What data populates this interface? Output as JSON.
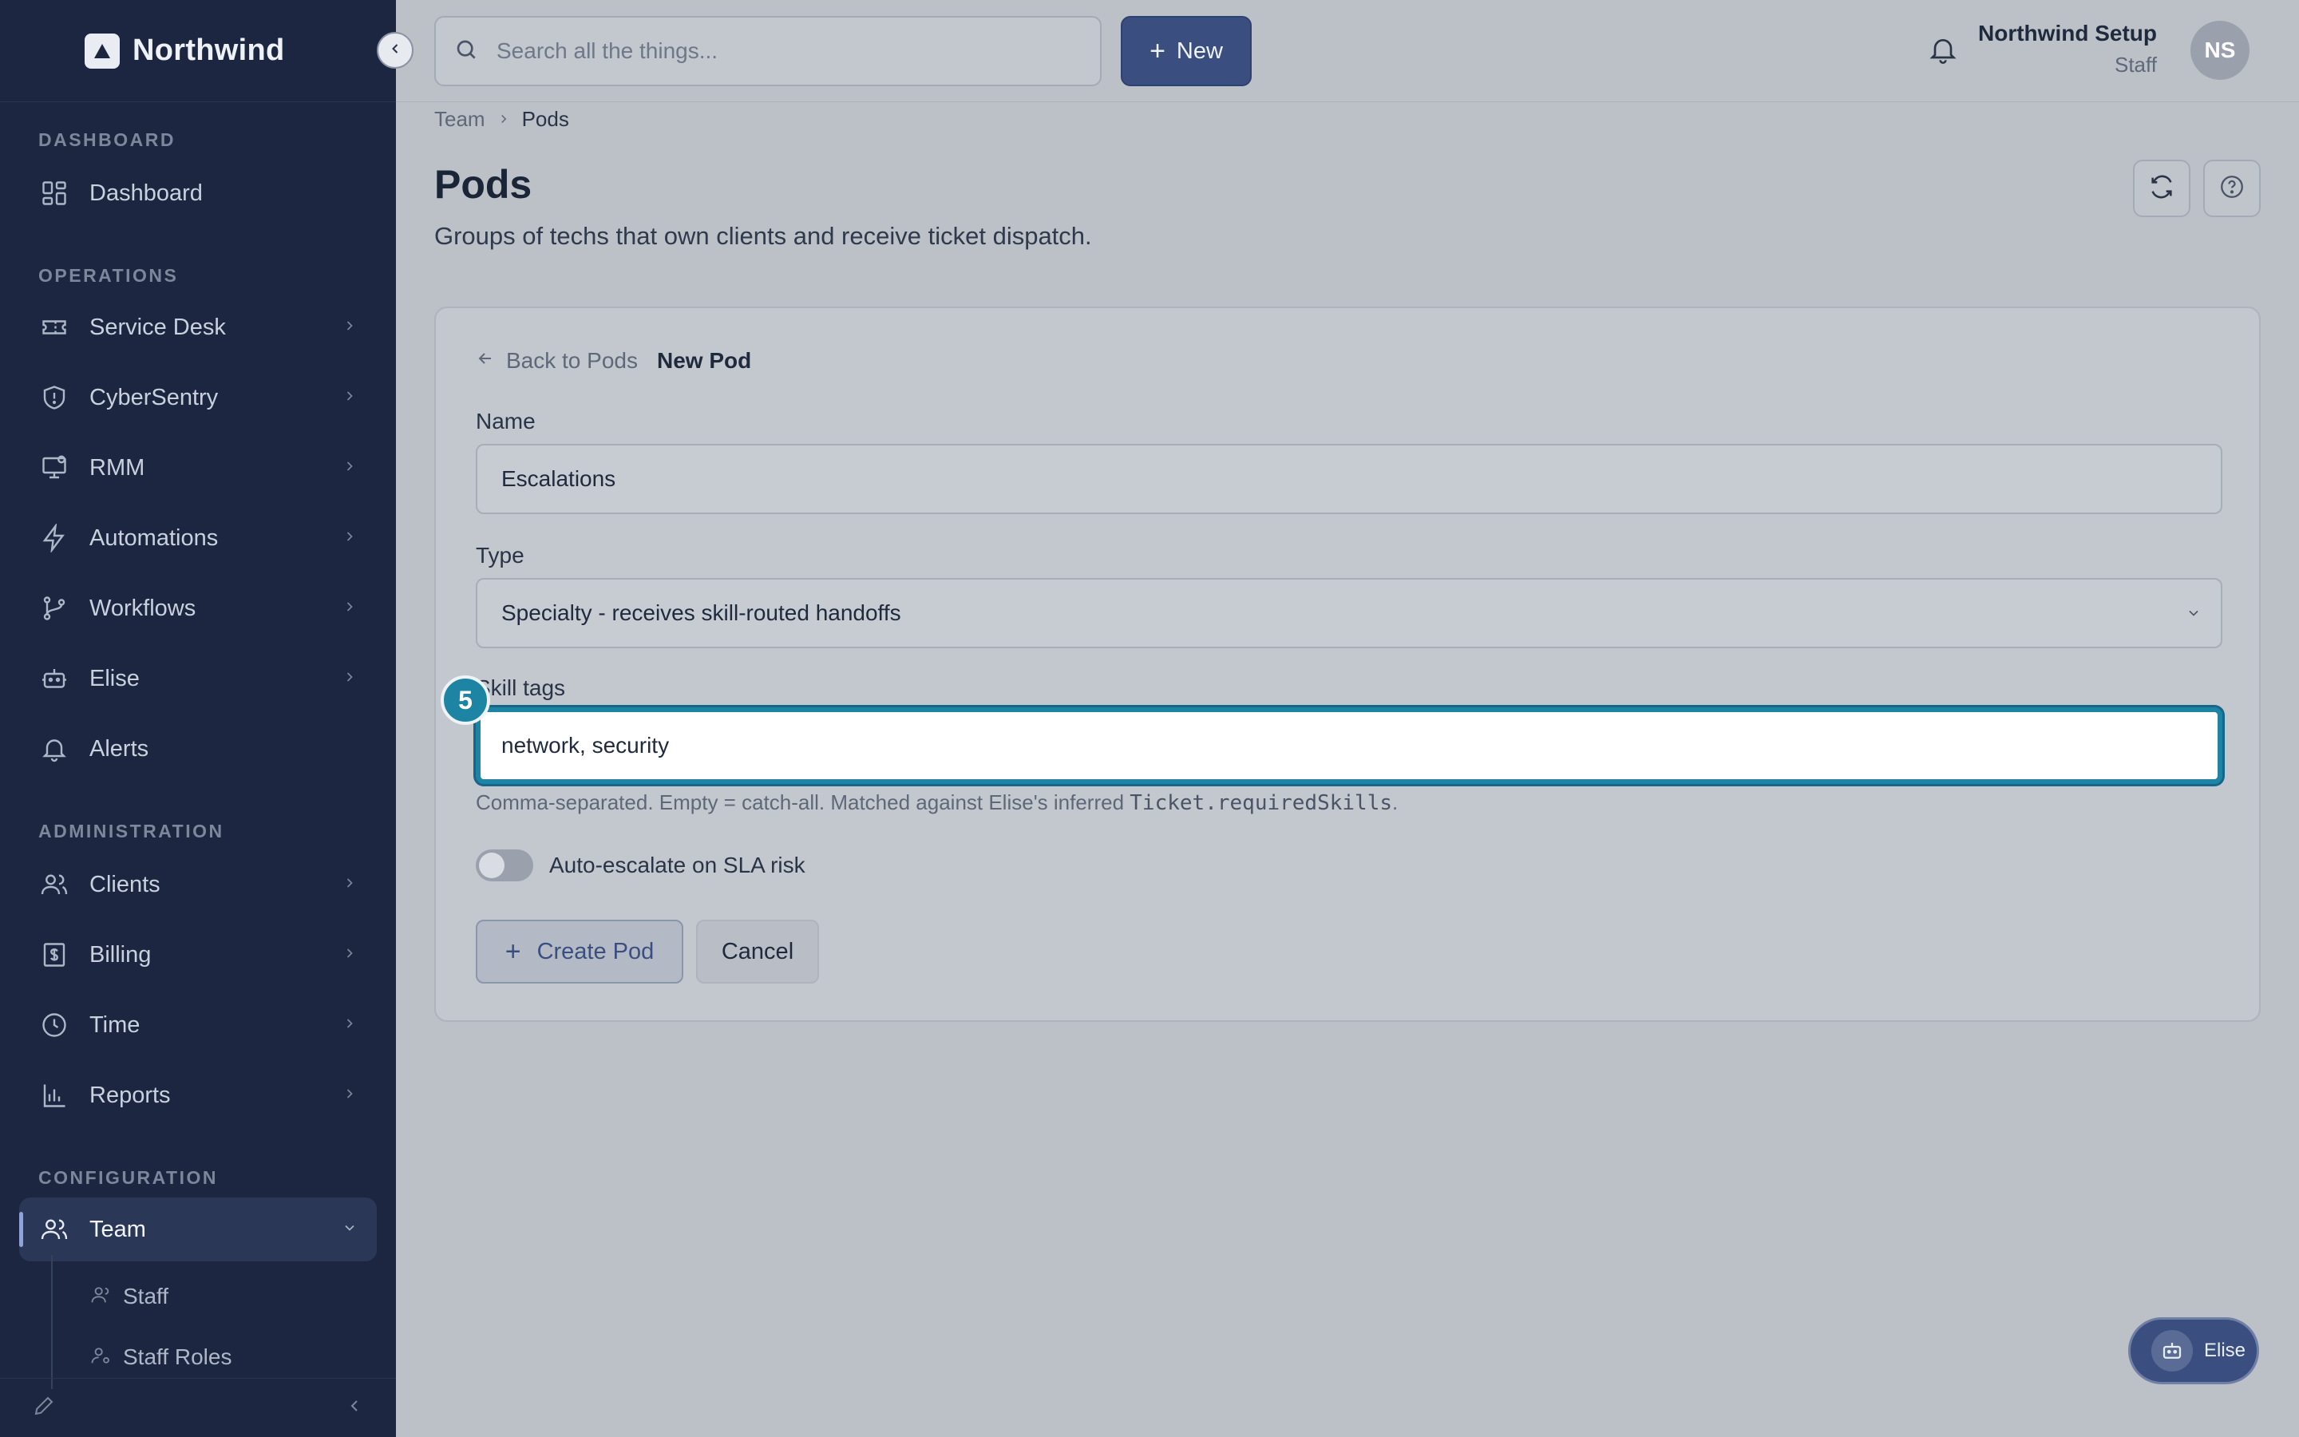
{
  "app": {
    "brand_name": "Northwind"
  },
  "sidebar": {
    "sections": {
      "dashboard": "DASHBOARD",
      "operations": "OPERATIONS",
      "administration": "ADMINISTRATION",
      "configuration": "CONFIGURATION"
    },
    "items": {
      "dashboard": "Dashboard",
      "service_desk": "Service Desk",
      "cybersentry": "CyberSentry",
      "rmm": "RMM",
      "automations": "Automations",
      "workflows": "Workflows",
      "elise": "Elise",
      "alerts": "Alerts",
      "clients": "Clients",
      "billing": "Billing",
      "time": "Time",
      "reports": "Reports",
      "team": "Team"
    },
    "sub_items": {
      "staff": "Staff",
      "staff_roles": "Staff Roles"
    },
    "active_item": "Team"
  },
  "topbar": {
    "search_placeholder": "Search all the things...",
    "new_label": "New",
    "user_name": "Northwind Setup",
    "user_role": "Staff",
    "avatar_initials": "NS"
  },
  "breadcrumb": {
    "parent": "Team",
    "current": "Pods"
  },
  "page": {
    "title": "Pods",
    "subtitle": "Groups of techs that own clients and receive ticket dispatch."
  },
  "form": {
    "back_label": "Back to Pods",
    "heading": "New Pod",
    "name_label": "Name",
    "name_value": "Escalations",
    "type_label": "Type",
    "type_value": "Specialty - receives skill-routed handoffs",
    "skill_tags_label": "Skill tags",
    "skill_tags_value": "network, security",
    "hint_prefix": "Comma-separated. Empty = catch-all. Matched against Elise's inferred ",
    "hint_code": "Ticket.requiredSkills",
    "hint_suffix": ".",
    "step_badge": "5",
    "toggle_label": "Auto-escalate on SLA risk",
    "toggle_on": false,
    "create_label": "Create Pod",
    "cancel_label": "Cancel"
  },
  "assistant_fab": {
    "label": "Elise"
  },
  "colors": {
    "sidebar_bg": "#1c2640",
    "accent": "#3a4f80",
    "focus_ring": "#1e84a3",
    "page_bg": "#bcc0c7"
  },
  "icons": {
    "brand": "triangle-logo-icon",
    "search": "search-icon",
    "bell": "bell-icon",
    "refresh": "refresh-icon",
    "help": "help-circle-icon"
  }
}
